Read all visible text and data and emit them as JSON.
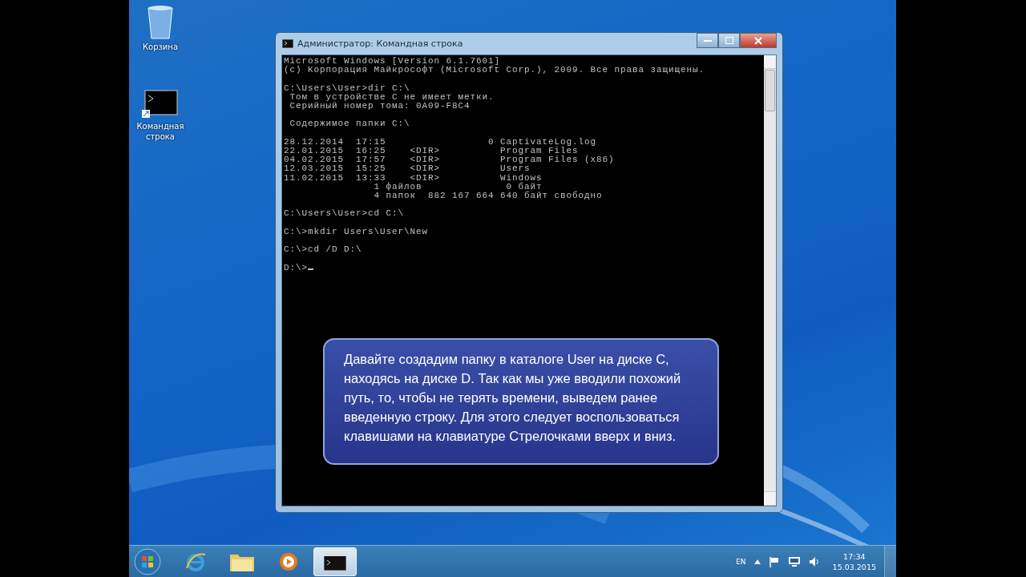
{
  "desktop_icons": [
    {
      "kind": "recycle",
      "label": "Корзина"
    },
    {
      "kind": "console",
      "label": "Командная строка"
    }
  ],
  "window": {
    "title": "Администратор: Командная строка",
    "console_blocks": [
      [
        "Microsoft Windows [Version 6.1.7601]",
        "(c) Корпорация Майкрософт (Microsoft Corp.), 2009. Все права защищены."
      ],
      [
        "C:\\Users\\User>dir C:\\",
        " Том в устройстве C не имеет метки.",
        " Серийный номер тома: 0A09-F8C4"
      ],
      [
        " Содержимое папки C:\\"
      ],
      [
        "28.12.2014  17:15                 0 CaptivateLog.log",
        "22.01.2015  16:25    <DIR>          Program Files",
        "04.02.2015  17:57    <DIR>          Program Files (x86)",
        "12.03.2015  15:25    <DIR>          Users",
        "11.02.2015  13:33    <DIR>          Windows",
        "               1 файлов              0 байт",
        "               4 папок  882 167 664 640 байт свободно"
      ],
      [
        "C:\\Users\\User>cd C:\\"
      ],
      [
        "C:\\>mkdir Users\\User\\New"
      ],
      [
        "C:\\>cd /D D:\\"
      ]
    ],
    "prompt": "D:\\>"
  },
  "callout": "Давайте создадим папку в каталоге User на диске С, находясь на диске D. Так как мы уже вводили похожий путь, то, чтобы не терять времени, выведем ранее введенную строку. Для этого следует воспользоваться клавишами на клавиатуре Стрелочками вверх и вниз.",
  "taskbar": {
    "items": [
      {
        "kind": "ie",
        "selected": false
      },
      {
        "kind": "folder",
        "selected": false
      },
      {
        "kind": "media",
        "selected": false
      },
      {
        "kind": "console",
        "selected": true
      }
    ],
    "language": "EN",
    "time": "17:34",
    "date": "15.03.2015"
  }
}
